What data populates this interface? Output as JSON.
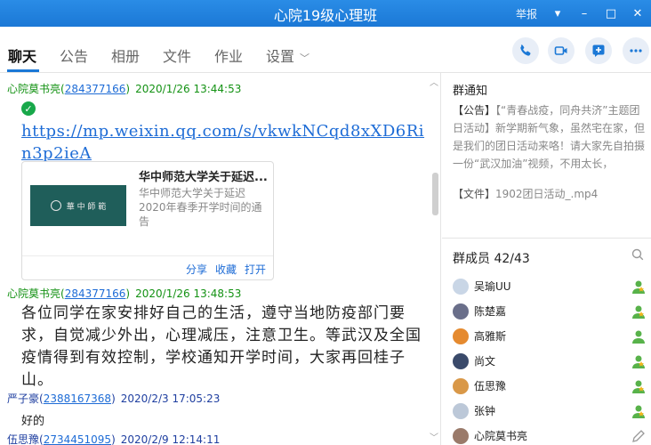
{
  "window": {
    "title": "心院19级心理班",
    "report_label": "举报",
    "controls": {
      "dropdown": "▾",
      "minimize": "–",
      "maximize": "□",
      "close": "✕"
    }
  },
  "tabs": [
    {
      "label": "聊天",
      "active": true
    },
    {
      "label": "公告"
    },
    {
      "label": "相册"
    },
    {
      "label": "文件"
    },
    {
      "label": "作业"
    },
    {
      "label": "设置"
    }
  ],
  "tab_arrow": "﹀",
  "toolbar_icons": [
    "phone-icon",
    "video-icon",
    "add-app-icon",
    "more-icon"
  ],
  "messages": [
    {
      "sender": "心院莫书亮",
      "paren_open": "(",
      "qq": "284377166",
      "paren_close": ")",
      "time": "2020/1/26 13:44:53",
      "link": "https://mp.weixin.qq.com/s/vkwkNCqd8xXD6Rin3p2ieA",
      "card": {
        "title": "华中师范大学关于延迟...",
        "desc": "华中师范大学关于延迟2020年春季开学时间的通告",
        "thumb_text": "華 中 師 範",
        "actions": [
          "分享",
          "收藏",
          "打开"
        ]
      }
    },
    {
      "sender": "心院莫书亮",
      "paren_open": "(",
      "qq": "284377166",
      "paren_close": ")",
      "time": "2020/1/26 13:48:53",
      "text": "各位同学在家安排好自己的生活，遵守当地防疫部门要求，自觉减少外出，心理减压，注意卫生。等武汉及全国疫情得到有效控制，学校通知开学时间，大家再回桂子山。"
    },
    {
      "sender": "严子豪",
      "paren_open": "(",
      "qq": "2388167368",
      "paren_close": ")",
      "time": "2020/2/3 17:05:23",
      "text": "好的"
    },
    {
      "sender": "伍思豫",
      "paren_open": "(",
      "qq": "2734451095",
      "paren_close": ")",
      "time": "2020/2/9 12:14:11"
    }
  ],
  "notice": {
    "title": "群通知",
    "tag": "【公告】",
    "text": "【“青春战疫，同舟共济”主题团日活动】新学期新气象，虽然宅在家，但是我们的团日活动来咯！请大家先自拍摄一份“武汉加油”视频，不用太长，",
    "file_tag": "【文件】",
    "file_name": "1902团日活动_.mp4"
  },
  "members": {
    "title": "群成员 42/43",
    "list": [
      {
        "name": "吴瑜UU",
        "avatar_color": "#c9d6e6"
      },
      {
        "name": "陈楚嘉",
        "avatar_color": "#6a6f8a"
      },
      {
        "name": "高雅斯",
        "avatar_color": "#e58a2f"
      },
      {
        "name": "尚文",
        "avatar_color": "#3a4a6a"
      },
      {
        "name": "伍思豫",
        "avatar_color": "#d99848"
      },
      {
        "name": "张钟",
        "avatar_color": "#bcc8d8"
      },
      {
        "name": "心院莫书亮",
        "avatar_color": "#9a7a6a"
      }
    ]
  },
  "colors": {
    "accent": "#1b78d6",
    "green_name": "#149214",
    "link": "#1e6cd6"
  }
}
